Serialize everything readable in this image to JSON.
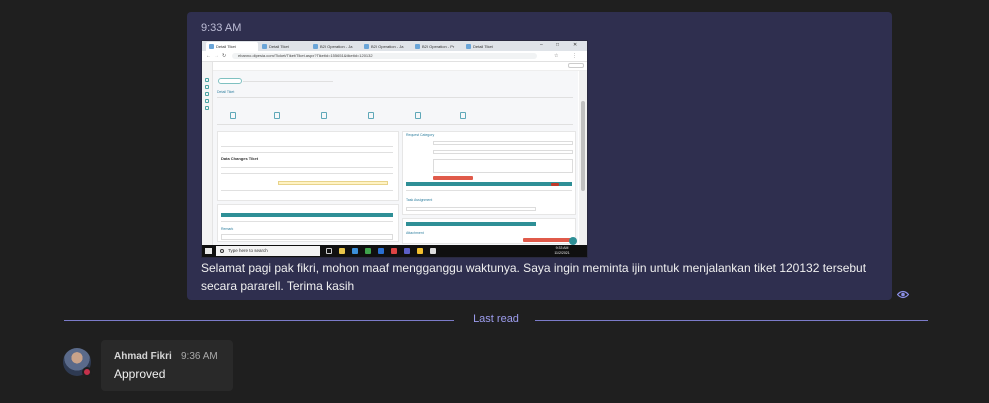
{
  "message": {
    "time": "9:33 AM",
    "text": "Selamat pagi pak fikri, mohon maaf mengganggu waktunya. Saya ingin meminta ijin untuk menjalankan tiket 120132 tersebut secara pararell. Terima kasih"
  },
  "divider": {
    "label": "Last read"
  },
  "reply": {
    "author": "Ahmad Fikri",
    "time": "9:36 AM",
    "text": "Approved"
  },
  "screenshot": {
    "tabs": [
      "Detail Tiket",
      "Detail Tiket",
      "B2I Operation - Ja",
      "B2I Operation - Ja",
      "B2I Operation - Pr",
      "Detail Tiket"
    ],
    "url": "ebanno.dipesia.com/Ticket/Tiket/Tiket.aspx?Tiketid=155651&tiketid=120132",
    "taskbar_search": "Type here to search",
    "clock_time": "9:33 AM",
    "clock_date": "11/2/2021",
    "section_detail": "Detail Tiket",
    "section_request": "Request Category",
    "section_changes": "Data Changes Tiket",
    "section_assign": "Task Assignment",
    "section_attachment": "Attachment",
    "section_remark": "Remark"
  }
}
